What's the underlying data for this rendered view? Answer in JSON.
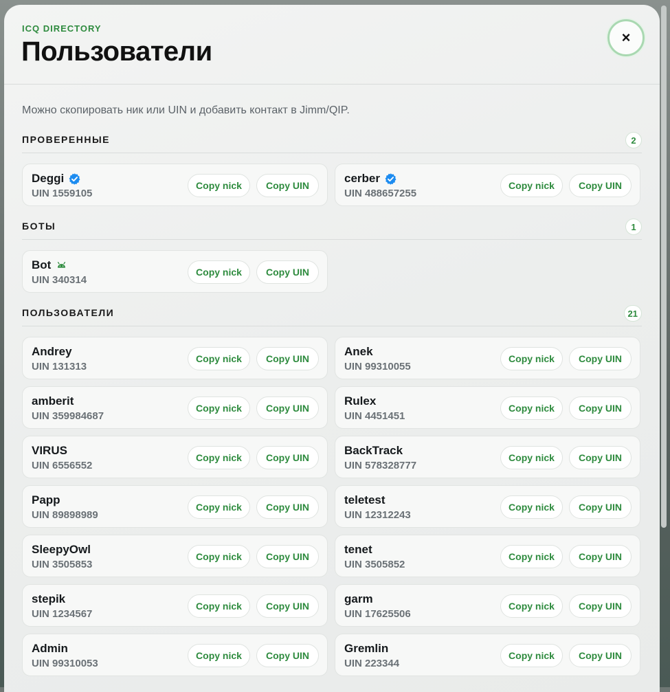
{
  "header": {
    "eyebrow": "ICQ DIRECTORY",
    "title": "Пользователи",
    "close_label": "×"
  },
  "hint": "Можно скопировать ник или UIN и добавить контакт в Jimm/QIP.",
  "buttons": {
    "copy_nick": "Copy nick",
    "copy_uin": "Copy UIN"
  },
  "colors": {
    "accent": "#2e8b3e",
    "verified": "#1d8cf0",
    "bot": "#2e8b3e"
  },
  "sections": [
    {
      "title": "ПРОВЕРЕННЫЕ",
      "count": "2",
      "users": [
        {
          "nick": "Deggi",
          "uin": "UIN 1559105",
          "badge": "verified-icon"
        },
        {
          "nick": "cerber",
          "uin": "UIN 488657255",
          "badge": "verified-icon"
        }
      ]
    },
    {
      "title": "БОТЫ",
      "count": "1",
      "users": [
        {
          "nick": "Bot",
          "uin": "UIN 340314",
          "badge": "android-icon"
        }
      ]
    },
    {
      "title": "ПОЛЬЗОВАТЕЛИ",
      "count": "21",
      "users": [
        {
          "nick": "Andrey",
          "uin": "UIN 131313"
        },
        {
          "nick": "Anek",
          "uin": "UIN 99310055"
        },
        {
          "nick": "amberit",
          "uin": "UIN 359984687"
        },
        {
          "nick": "Rulex",
          "uin": "UIN 4451451"
        },
        {
          "nick": "VIRUS",
          "uin": "UIN 6556552"
        },
        {
          "nick": "BackTrack",
          "uin": "UIN 578328777"
        },
        {
          "nick": "Papp",
          "uin": "UIN 89898989"
        },
        {
          "nick": "teletest",
          "uin": "UIN 12312243"
        },
        {
          "nick": "SleepyOwl",
          "uin": "UIN 3505853"
        },
        {
          "nick": "tenet",
          "uin": "UIN 3505852"
        },
        {
          "nick": "stepik",
          "uin": "UIN 1234567"
        },
        {
          "nick": "garm",
          "uin": "UIN 17625506"
        },
        {
          "nick": "Admin",
          "uin": "UIN 99310053"
        },
        {
          "nick": "Gremlin",
          "uin": "UIN 223344"
        }
      ]
    }
  ]
}
